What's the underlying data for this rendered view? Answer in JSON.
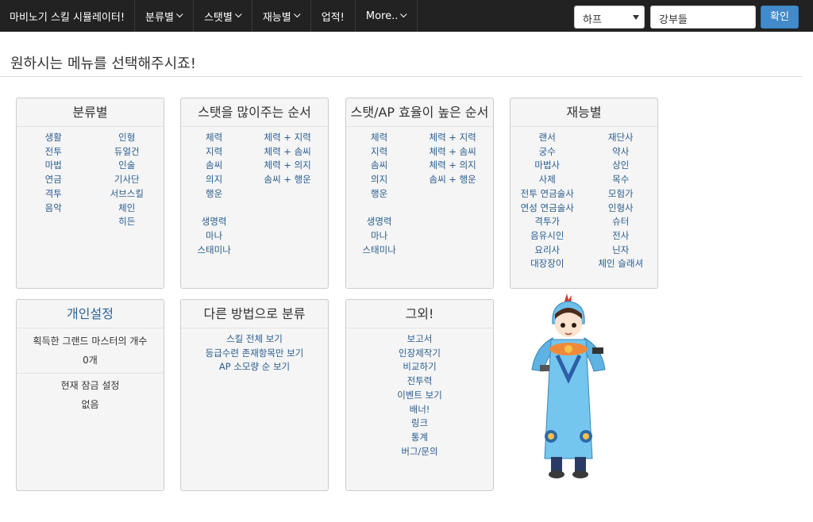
{
  "navbar": {
    "brand": "마비노기 스킬 시뮬레이터!",
    "items": [
      "분류별",
      "스탯별",
      "재능별",
      "업적!",
      "More.."
    ],
    "select_value": "하프",
    "input_value": "강부들",
    "submit_label": "확인"
  },
  "page_title": "원하시는 메뉴를 선택해주시죠!",
  "panels": {
    "category": {
      "title": "분류별",
      "left": [
        "생활",
        "전투",
        "마법",
        "연금",
        "격투",
        "음악"
      ],
      "right": [
        "인형",
        "듀얼건",
        "인술",
        "기사단",
        "서브스킬",
        "체인",
        "히든"
      ]
    },
    "stat_most": {
      "title": "스탯을 많이주는 순서",
      "left": [
        "체력",
        "지력",
        "솜씨",
        "의지",
        "행운"
      ],
      "left2": [
        "생명력",
        "마나",
        "스태미나"
      ],
      "right": [
        "체력 + 지력",
        "체력 + 솜씨",
        "체력 + 의지",
        "솜씨 + 행운"
      ]
    },
    "stat_eff": {
      "title": "스탯/AP 효율이 높은 순서",
      "left": [
        "체력",
        "지력",
        "솜씨",
        "의지",
        "행운"
      ],
      "left2": [
        "생명력",
        "마나",
        "스태미나"
      ],
      "right": [
        "체력 + 지력",
        "체력 + 솜씨",
        "체력 + 의지",
        "솜씨 + 행운"
      ]
    },
    "talent": {
      "title": "재능별",
      "left": [
        "랜서",
        "궁수",
        "마법사",
        "사제",
        "전투 연금술사",
        "연성 연금술사",
        "격투가",
        "음유시인",
        "요리사",
        "대장장이"
      ],
      "right": [
        "재단사",
        "약사",
        "상인",
        "목수",
        "모험가",
        "인형사",
        "슈터",
        "전사",
        "닌자",
        "체인 슬래셔"
      ]
    },
    "personal": {
      "title": "개인설정",
      "label1": "획득한 그랜드 마스터의 개수",
      "value1": "0개",
      "label2": "현재 잠금 설정",
      "value2": "없음"
    },
    "other_way": {
      "title": "다른 방법으로 분류",
      "links": [
        "스킬 전체 보기",
        "등급수련 존재항목만 보기",
        "AP 소모량 순 보기"
      ]
    },
    "etc": {
      "title": "그외!",
      "links": [
        "보고서",
        "인장제작기",
        "비교하기",
        "전투력",
        "이벤트 보기",
        "배너!",
        "링크",
        "통계",
        "버그/문의"
      ]
    }
  }
}
